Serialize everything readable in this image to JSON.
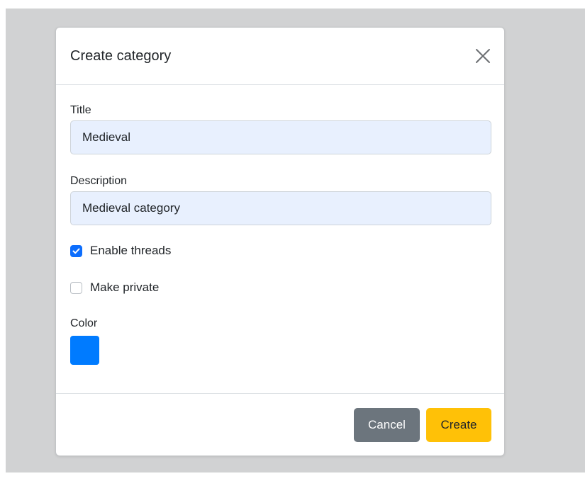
{
  "modal": {
    "title": "Create category",
    "close_icon": "close-icon"
  },
  "form": {
    "title_label": "Title",
    "title_value": "Medieval",
    "description_label": "Description",
    "description_value": "Medieval category",
    "enable_threads_label": "Enable threads",
    "enable_threads_checked": true,
    "make_private_label": "Make private",
    "make_private_checked": false,
    "color_label": "Color",
    "color_value": "#007bff"
  },
  "footer": {
    "cancel_label": "Cancel",
    "create_label": "Create"
  },
  "colors": {
    "primary": "#0d6efd",
    "cancel": "#6c757d",
    "create": "#ffc107",
    "input_bg": "#e8f0fe",
    "backdrop": "#d1d2d3"
  }
}
